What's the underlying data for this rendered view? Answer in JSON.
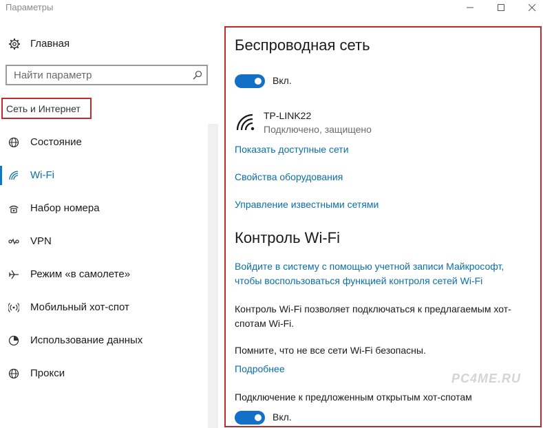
{
  "window": {
    "title": "Параметры",
    "controls": [
      "minimize-icon",
      "maximize-icon",
      "close-icon"
    ]
  },
  "sidebar": {
    "home_label": "Главная",
    "search_placeholder": "Найти параметр",
    "section_title": "Сеть и Интернет",
    "items": [
      {
        "label": "Состояние",
        "icon": "globe-icon",
        "active": false
      },
      {
        "label": "Wi-Fi",
        "icon": "wifi-icon",
        "active": true
      },
      {
        "label": "Набор номера",
        "icon": "dialup-icon",
        "active": false
      },
      {
        "label": "VPN",
        "icon": "vpn-icon",
        "active": false
      },
      {
        "label": "Режим «в самолете»",
        "icon": "airplane-icon",
        "active": false
      },
      {
        "label": "Мобильный хот-спот",
        "icon": "hotspot-icon",
        "active": false
      },
      {
        "label": "Использование данных",
        "icon": "data-usage-icon",
        "active": false
      },
      {
        "label": "Прокси",
        "icon": "globe-icon",
        "active": false
      }
    ]
  },
  "main": {
    "wireless_title": "Беспроводная сеть",
    "wifi_toggle": {
      "label": "Вкл.",
      "on": true
    },
    "network": {
      "name": "TP-LINK22",
      "status": "Подключено, защищено"
    },
    "links": {
      "show_networks": "Показать доступные сети",
      "hardware_properties": "Свойства оборудования",
      "manage_known": "Управление известными сетями"
    },
    "wifi_sense_title": "Контроль Wi-Fi",
    "signin_link_line1": "Войдите в систему с помощью учетной записи Майкрософт,",
    "signin_link_line2": "чтобы воспользоваться функцией контроля сетей Wi-Fi",
    "desc_line1": "Контроль Wi-Fi позволяет подключаться к предлагаемым хот-",
    "desc_line2": "спотам Wi-Fi.",
    "warning": "Помните, что не все сети Wi-Fi безопасны.",
    "more_link": "Подробнее",
    "hotspot_label": "Подключение к предложенным открытым хот-спотам",
    "hotspot_toggle": {
      "label": "Вкл.",
      "on": true
    }
  },
  "watermark": "PC4ME.RU",
  "colors": {
    "accent": "#1270c6",
    "link": "#0a6ea8",
    "highlight": "#c0282a"
  }
}
